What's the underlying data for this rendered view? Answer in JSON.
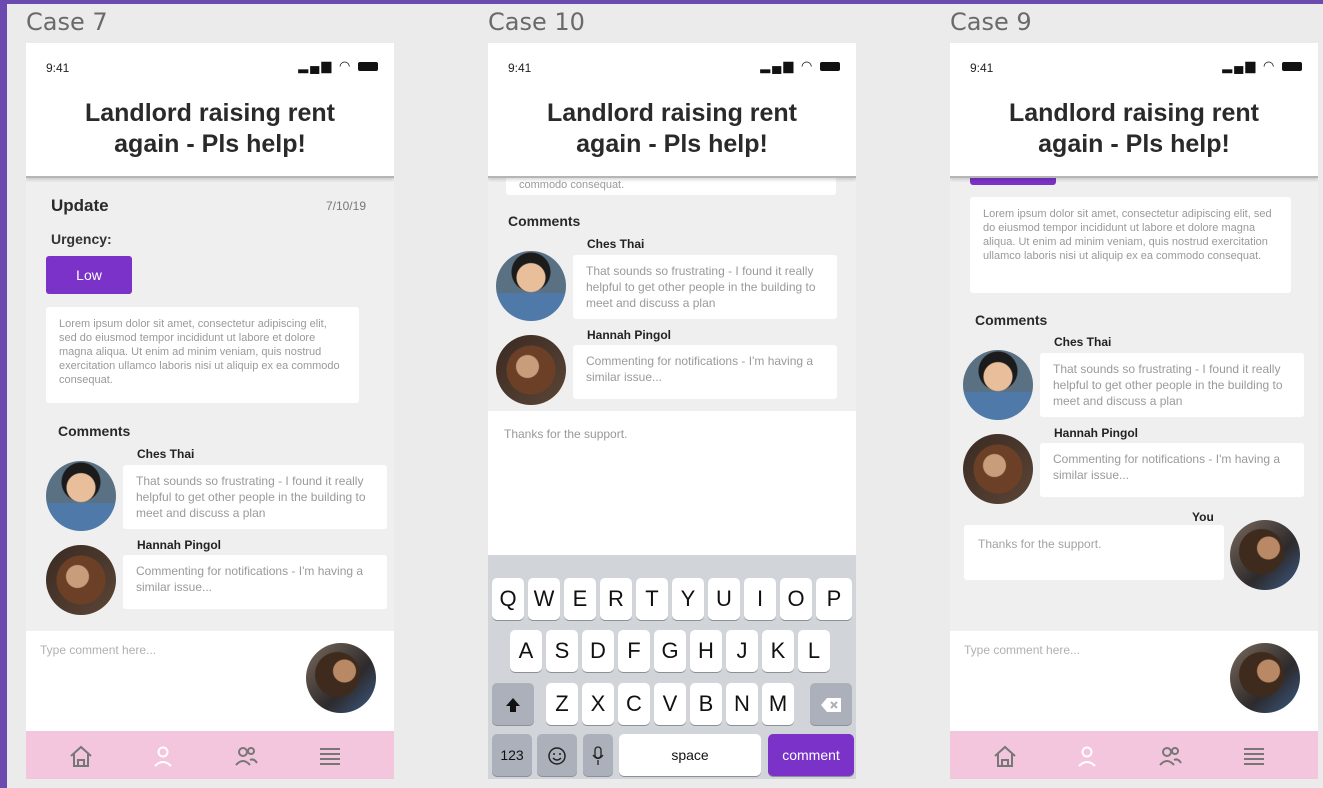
{
  "colors": {
    "accent": "#7b32c8",
    "navbar": "#f4c6de",
    "frame": "#6b4bb0"
  },
  "status": {
    "time": "9:41",
    "icons": [
      "signal-icon",
      "wifi-icon",
      "battery-icon"
    ]
  },
  "post_title_line1": "Landlord raising rent",
  "post_title_line2": "again - Pls help!",
  "lorem": "Lorem ipsum dolor sit amet, consectetur adipiscing elit, sed do eiusmod tempor incididunt ut labore et dolore magna aliqua. Ut enim ad minim veniam, quis nostrud exercitation ullamco laboris nisi ut aliquip ex ea commodo consequat.",
  "lorem_tail": "commodo consequat.",
  "comments_heading": "Comments",
  "comments": [
    {
      "author": "Ches Thai",
      "text": "That sounds so frustrating - I found it really helpful to get other people in the building to meet and discuss a plan"
    },
    {
      "author": "Hannah Pingol",
      "text": "Commenting for notifications -  I'm having a similar issue..."
    }
  ],
  "nav_icons": [
    "home-icon",
    "profile-icon",
    "people-icon",
    "menu-icon"
  ],
  "case7": {
    "label": "Case 7",
    "update_heading": "Update",
    "update_date": "7/10/19",
    "urgency_label": "Urgency:",
    "urgency_value": "Low",
    "input_placeholder": "Type comment here..."
  },
  "case10": {
    "label": "Case 10",
    "draft_text": "Thanks for the support.",
    "keyboard": {
      "row1": [
        "Q",
        "W",
        "E",
        "R",
        "T",
        "Y",
        "U",
        "I",
        "O",
        "P"
      ],
      "row2": [
        "A",
        "S",
        "D",
        "F",
        "G",
        "H",
        "J",
        "K",
        "L"
      ],
      "row3": [
        "Z",
        "X",
        "C",
        "V",
        "B",
        "N",
        "M"
      ],
      "numbers_key": "123",
      "space_key": "space",
      "comment_key": "comment"
    }
  },
  "case9": {
    "label": "Case 9",
    "you_label": "You",
    "you_comment": "Thanks for the support.",
    "input_placeholder": "Type comment here..."
  }
}
